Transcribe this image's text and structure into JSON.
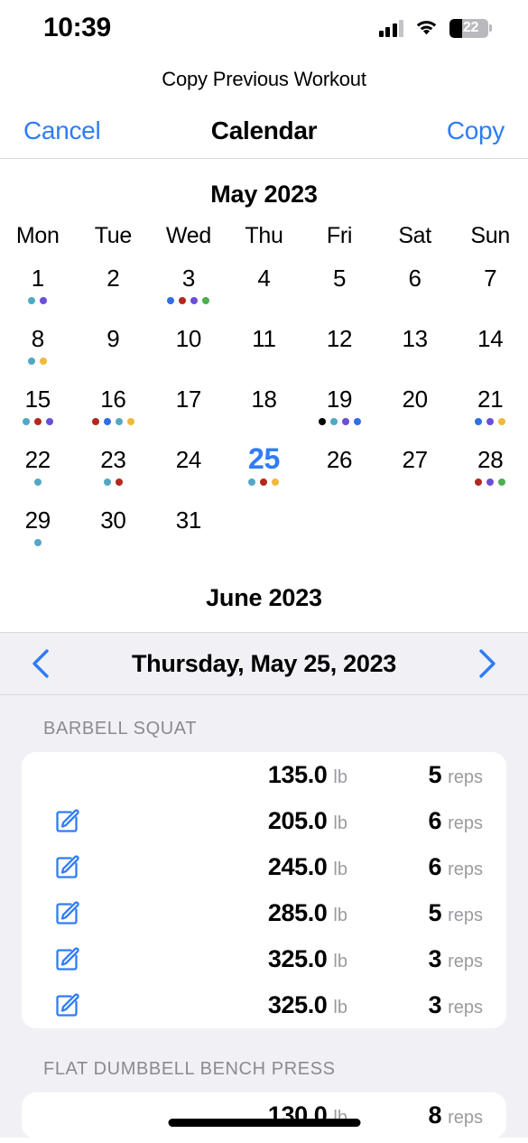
{
  "status_bar": {
    "time": "10:39",
    "battery_percent": "22",
    "signal_icon": "cellular-signal-icon",
    "wifi_icon": "wifi-icon",
    "battery_icon": "battery-icon"
  },
  "sheet": {
    "title": "Copy Previous Workout"
  },
  "navbar": {
    "cancel_label": "Cancel",
    "title": "Calendar",
    "copy_label": "Copy"
  },
  "calendar": {
    "month_label": "May 2023",
    "next_month_label": "June 2023",
    "weekdays": [
      "Mon",
      "Tue",
      "Wed",
      "Thu",
      "Fri",
      "Sat",
      "Sun"
    ],
    "selected_day": "25",
    "accent_color": "#2f7cf6",
    "dot_colors": {
      "blue": "#2f6fe0",
      "red": "#b2281f",
      "purple": "#6a4fd8",
      "green": "#4caf50",
      "cyan": "#51a8c4",
      "yellow": "#f0b83c",
      "black": "#000000"
    },
    "days": [
      {
        "num": "1",
        "dots": [
          "cyan",
          "purple"
        ]
      },
      {
        "num": "2",
        "dots": []
      },
      {
        "num": "3",
        "dots": [
          "blue",
          "red",
          "purple",
          "green"
        ]
      },
      {
        "num": "4",
        "dots": []
      },
      {
        "num": "5",
        "dots": []
      },
      {
        "num": "6",
        "dots": []
      },
      {
        "num": "7",
        "dots": []
      },
      {
        "num": "8",
        "dots": [
          "cyan",
          "yellow"
        ]
      },
      {
        "num": "9",
        "dots": []
      },
      {
        "num": "10",
        "dots": []
      },
      {
        "num": "11",
        "dots": []
      },
      {
        "num": "12",
        "dots": []
      },
      {
        "num": "13",
        "dots": []
      },
      {
        "num": "14",
        "dots": []
      },
      {
        "num": "15",
        "dots": [
          "cyan",
          "red",
          "purple"
        ]
      },
      {
        "num": "16",
        "dots": [
          "red",
          "blue",
          "cyan",
          "yellow"
        ]
      },
      {
        "num": "17",
        "dots": []
      },
      {
        "num": "18",
        "dots": []
      },
      {
        "num": "19",
        "dots": [
          "black",
          "cyan",
          "purple",
          "blue"
        ]
      },
      {
        "num": "20",
        "dots": []
      },
      {
        "num": "21",
        "dots": [
          "blue",
          "purple",
          "yellow"
        ]
      },
      {
        "num": "22",
        "dots": [
          "cyan"
        ]
      },
      {
        "num": "23",
        "dots": [
          "cyan",
          "red"
        ]
      },
      {
        "num": "24",
        "dots": []
      },
      {
        "num": "25",
        "dots": [
          "cyan",
          "red",
          "yellow"
        ],
        "selected": true
      },
      {
        "num": "26",
        "dots": []
      },
      {
        "num": "27",
        "dots": []
      },
      {
        "num": "28",
        "dots": [
          "red",
          "purple",
          "green"
        ]
      },
      {
        "num": "29",
        "dots": [
          "cyan"
        ]
      },
      {
        "num": "30",
        "dots": []
      },
      {
        "num": "31",
        "dots": []
      }
    ]
  },
  "date_nav": {
    "prev_icon": "chevron-left-icon",
    "next_icon": "chevron-right-icon",
    "date_label": "Thursday, May 25, 2023"
  },
  "workout": {
    "exercises": [
      {
        "name": "BARBELL SQUAT",
        "sets": [
          {
            "editable": false,
            "weight": "135.0",
            "weight_unit": "lb",
            "reps": "5",
            "reps_unit": "reps"
          },
          {
            "editable": true,
            "weight": "205.0",
            "weight_unit": "lb",
            "reps": "6",
            "reps_unit": "reps"
          },
          {
            "editable": true,
            "weight": "245.0",
            "weight_unit": "lb",
            "reps": "6",
            "reps_unit": "reps"
          },
          {
            "editable": true,
            "weight": "285.0",
            "weight_unit": "lb",
            "reps": "5",
            "reps_unit": "reps"
          },
          {
            "editable": true,
            "weight": "325.0",
            "weight_unit": "lb",
            "reps": "3",
            "reps_unit": "reps"
          },
          {
            "editable": true,
            "weight": "325.0",
            "weight_unit": "lb",
            "reps": "3",
            "reps_unit": "reps"
          }
        ]
      },
      {
        "name": "FLAT DUMBBELL BENCH PRESS",
        "sets": [
          {
            "editable": false,
            "weight": "130.0",
            "weight_unit": "lb",
            "reps": "8",
            "reps_unit": "reps"
          }
        ]
      }
    ]
  }
}
